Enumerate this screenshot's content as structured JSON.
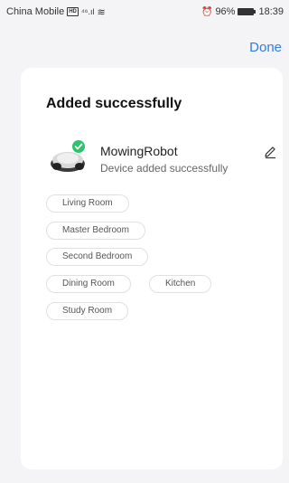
{
  "status_bar": {
    "carrier": "China Mobile",
    "hd": "HD",
    "signal": "⁴⁶.ıl",
    "wifi": "≋",
    "battery_percent": "96%",
    "time": "18:39"
  },
  "header": {
    "done_label": "Done"
  },
  "card": {
    "title": "Added successfully",
    "device": {
      "name": "MowingRobot",
      "status": "Device added successfully"
    },
    "rooms": [
      "Living Room",
      "Master Bedroom",
      "Second Bedroom",
      "Dining Room",
      "Kitchen",
      "Study Room"
    ]
  },
  "colors": {
    "accent": "#2f7de1",
    "success": "#2dc36a"
  }
}
